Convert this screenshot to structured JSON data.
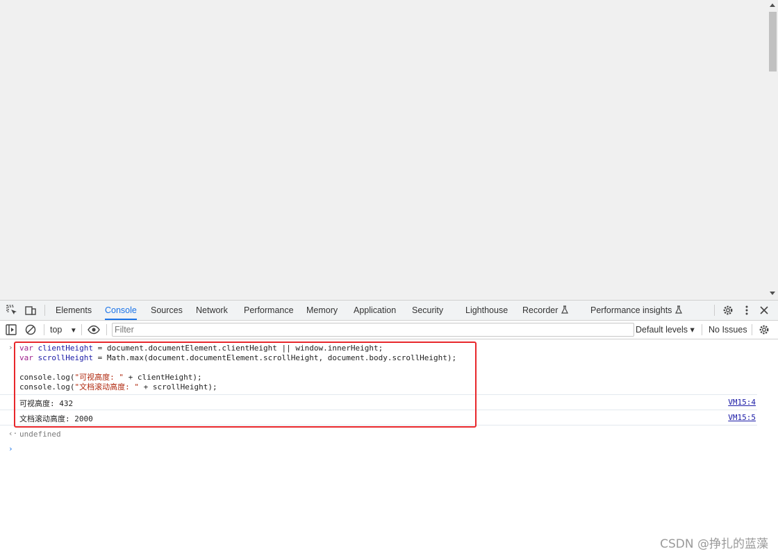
{
  "tabs": [
    "Elements",
    "Console",
    "Sources",
    "Network",
    "Performance",
    "Memory",
    "Application",
    "Security",
    "Lighthouse",
    "Recorder",
    "Performance insights"
  ],
  "active_tab": "Console",
  "toolbar": {
    "context": "top",
    "filter_placeholder": "Filter",
    "levels": "Default levels ▾",
    "issues": "No Issues"
  },
  "console": {
    "input_code": {
      "l1": {
        "k": "var",
        "v": "clientHeight",
        "r": " = document.documentElement.clientHeight || window.innerHeight;"
      },
      "l2": {
        "k": "var",
        "v": "scrollHeight",
        "r": " = Math.max(document.documentElement.scrollHeight, document.body.scrollHeight);"
      },
      "l3": {
        "a": "console.log(",
        "s": "\"可视高度: \"",
        "b": " + clientHeight);"
      },
      "l4": {
        "a": "console.log(",
        "s": "\"文档滚动高度: \"",
        "b": " + scrollHeight);"
      }
    },
    "outputs": [
      {
        "text": "可视高度: 432",
        "source": "VM15:4"
      },
      {
        "text": "文档滚动高度: 2000",
        "source": "VM15:5"
      }
    ],
    "return_value": "undefined"
  },
  "watermark": "CSDN @挣扎的蓝藻"
}
